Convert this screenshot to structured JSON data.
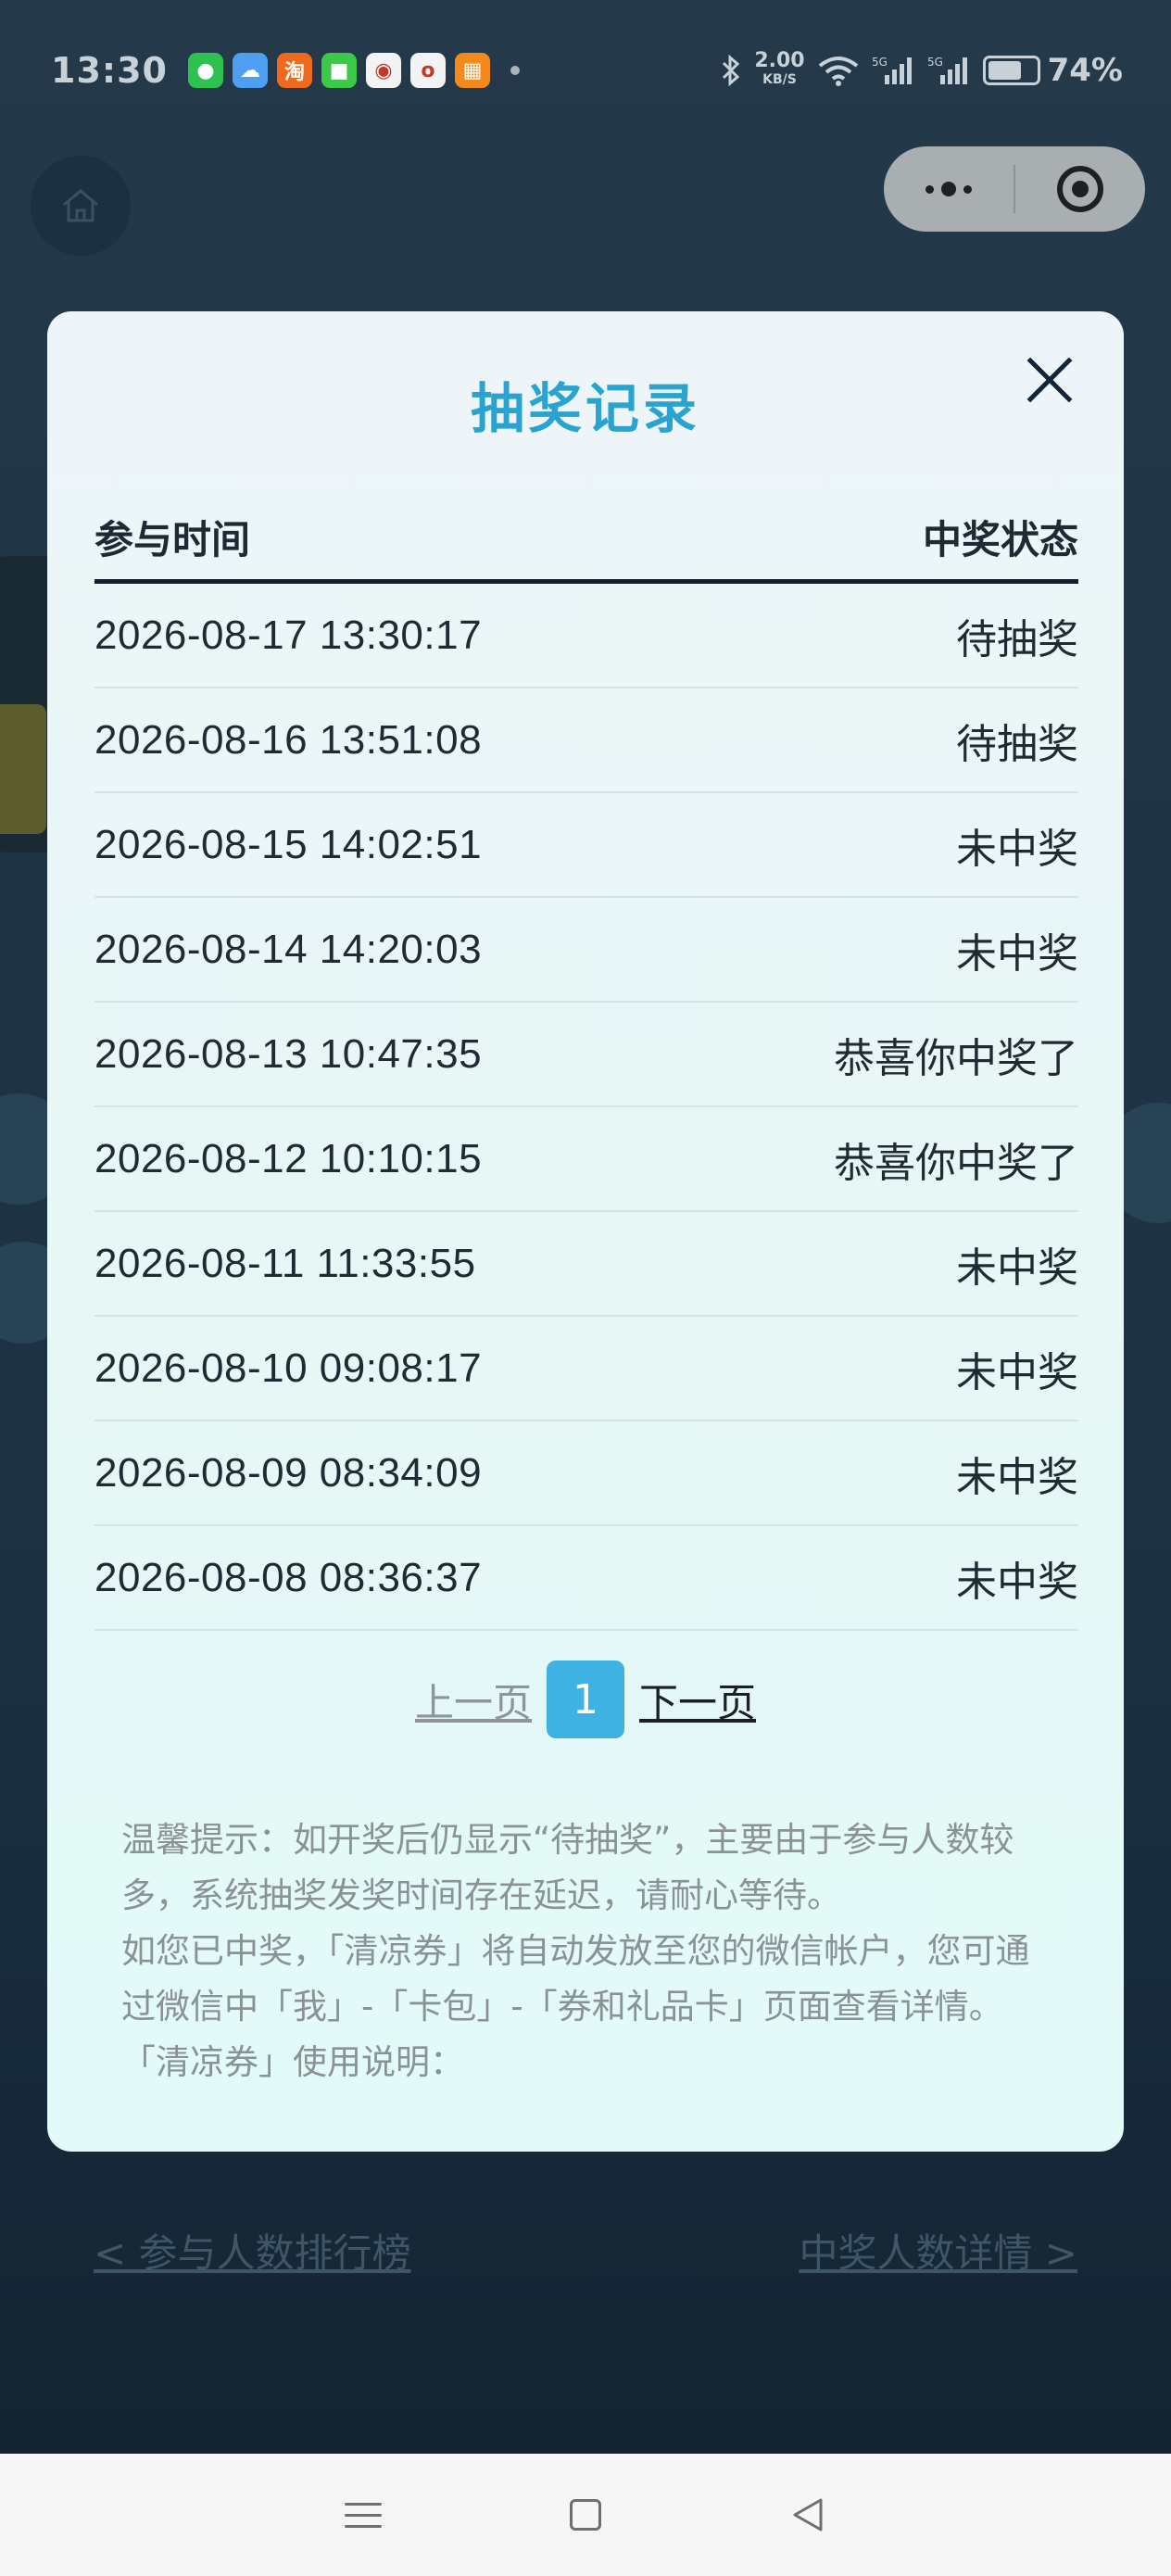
{
  "status_bar": {
    "time": "13:30",
    "net_speed": "2.00",
    "net_unit": "KB/S",
    "battery": "74%",
    "app_icons": [
      {
        "name": "wechat-icon",
        "color": "#2dc24f",
        "glyph": "●"
      },
      {
        "name": "weather-icon",
        "color": "#4e9ff0",
        "glyph": "☁"
      },
      {
        "name": "taobao-icon",
        "color": "#f06a1d",
        "glyph": "淘"
      },
      {
        "name": "messages-icon",
        "color": "#3cc94a",
        "glyph": "■"
      },
      {
        "name": "bank-icon",
        "color": "#f3f3f3",
        "glyph": "◉"
      },
      {
        "name": "oppo-icon",
        "color": "#f3f3f3",
        "glyph": "o"
      },
      {
        "name": "video-icon",
        "color": "#f38a1d",
        "glyph": "▦"
      }
    ]
  },
  "modal": {
    "title": "抽奖记录",
    "header_time": "参与时间",
    "header_status": "中奖状态",
    "rows": [
      {
        "time": "2026-08-17 13:30:17",
        "status": "待抽奖"
      },
      {
        "time": "2026-08-16 13:51:08",
        "status": "待抽奖"
      },
      {
        "time": "2026-08-15 14:02:51",
        "status": "未中奖"
      },
      {
        "time": "2026-08-14 14:20:03",
        "status": "未中奖"
      },
      {
        "time": "2026-08-13 10:47:35",
        "status": "恭喜你中奖了"
      },
      {
        "time": "2026-08-12 10:10:15",
        "status": "恭喜你中奖了"
      },
      {
        "time": "2026-08-11 11:33:55",
        "status": "未中奖"
      },
      {
        "time": "2026-08-10 09:08:17",
        "status": "未中奖"
      },
      {
        "time": "2026-08-09 08:34:09",
        "status": "未中奖"
      },
      {
        "time": "2026-08-08 08:36:37",
        "status": "未中奖"
      }
    ],
    "pager": {
      "prev": "上一页",
      "current": "1",
      "next": "下一页"
    },
    "tips": [
      "温馨提示：如开奖后仍显示“待抽奖”，主要由于参与人数较多，系统抽奖发奖时间存在延迟，请耐心等待。",
      "如您已中奖，「清凉券」将自动发放至您的微信帐户，您可通过微信中「我」-「卡包」-「券和礼品卡」页面查看详情。",
      "「清凉券」使用说明："
    ]
  },
  "background": {
    "left_link": "< 参与人数排行榜",
    "right_link": "中奖人数详情 >"
  }
}
